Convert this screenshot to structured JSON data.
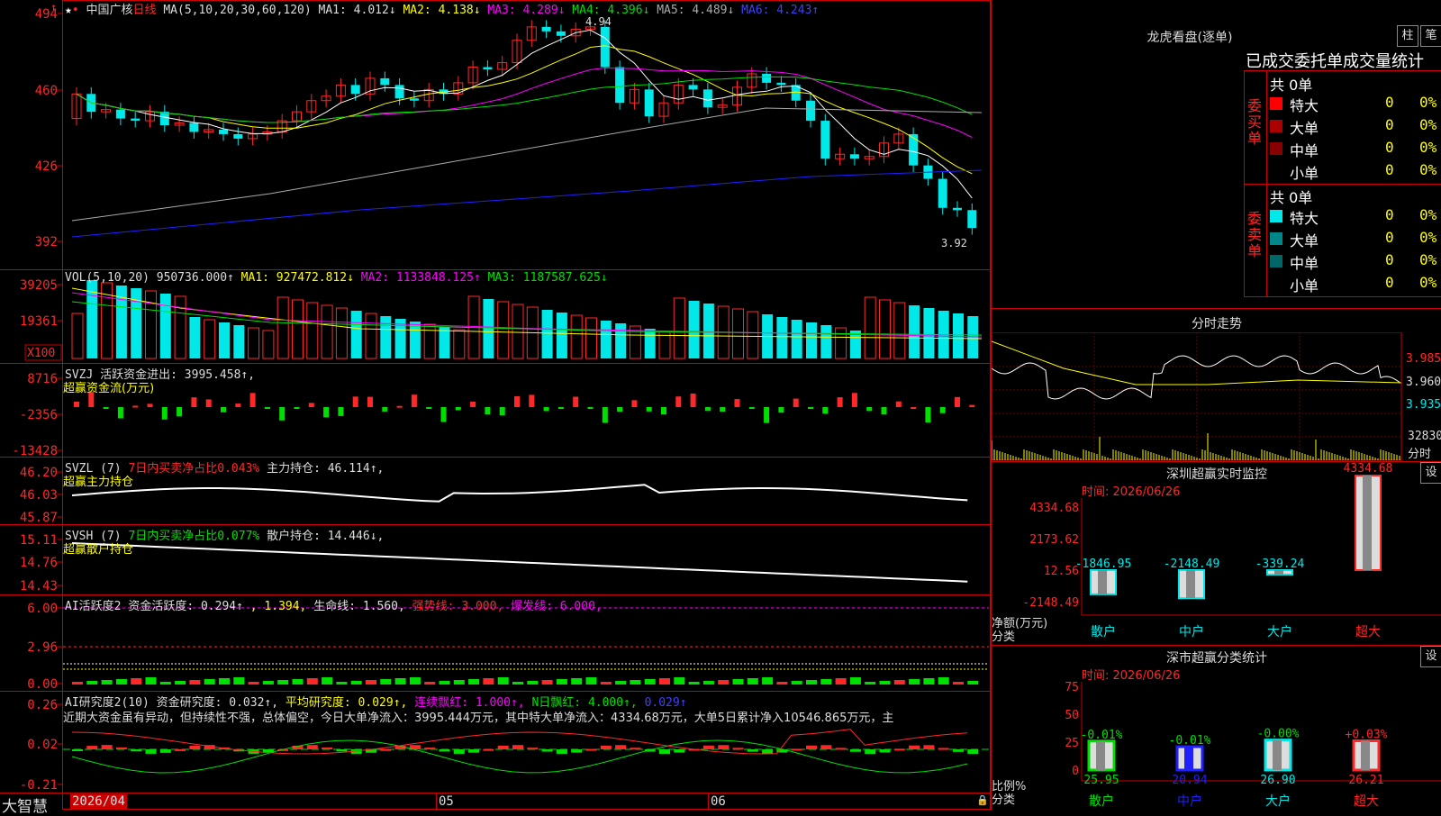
{
  "stock": {
    "name": "中国广核",
    "period": "日线"
  },
  "brand": "大智慧",
  "colors": {
    "up": "#ff2828",
    "down": "#00e8e8",
    "axis": "#cc0000",
    "text": "#dddddd",
    "yellow": "#ffff00",
    "magenta": "#ff00ff",
    "green": "#00e000",
    "white": "#ffffff",
    "blue": "#2020ff",
    "grey": "#aaaaaa"
  },
  "price_panel": {
    "legend": [
      {
        "text": "MA(5,10,20,30,60,120)",
        "color": "#dddddd"
      },
      {
        "text": "MA1: 4.012↓",
        "color": "#dddddd"
      },
      {
        "text": "MA2: 4.138↓",
        "color": "#ffff00"
      },
      {
        "text": "MA3: 4.289↓",
        "color": "#ff00ff"
      },
      {
        "text": "MA4: 4.396↓",
        "color": "#00e000"
      },
      {
        "text": "MA5: 4.489↓",
        "color": "#aaaaaa"
      },
      {
        "text": "MA6: 4.243↑",
        "color": "#4040ff"
      }
    ],
    "yticks": [
      "494",
      "460",
      "426",
      "392"
    ],
    "high_label": "4.94",
    "low_label": "3.92"
  },
  "vol_panel": {
    "legend": [
      {
        "text": "VOL(5,10,20)",
        "color": "#dddddd"
      },
      {
        "text": "950736.000↑",
        "color": "#dddddd"
      },
      {
        "text": "MA1: 927472.812↓",
        "color": "#ffff00"
      },
      {
        "text": "MA2: 1133848.125↑",
        "color": "#ff00ff"
      },
      {
        "text": "MA3: 1187587.625↓",
        "color": "#00e000"
      }
    ],
    "yticks": [
      "39205",
      "19361"
    ],
    "unit": "X100"
  },
  "svzj_panel": {
    "legend": [
      {
        "text": "SVZJ",
        "color": "#dddddd"
      },
      {
        "text": "活跃资金进出: 3995.458↑,",
        "color": "#dddddd"
      }
    ],
    "sub": "超赢资金流(万元)",
    "yticks": [
      "8716",
      "-2356",
      "-13428"
    ]
  },
  "svzl_panel": {
    "legend": [
      {
        "text": "SVZL (7)",
        "color": "#dddddd"
      },
      {
        "text": "7日内买卖净占比0.043%",
        "color": "#ff2828"
      },
      {
        "text": "主力持仓: 46.114↑,",
        "color": "#dddddd"
      }
    ],
    "sub": "超赢主力持仓",
    "yticks": [
      "46.20",
      "46.03",
      "45.87"
    ]
  },
  "svsh_panel": {
    "legend": [
      {
        "text": "SVSH (7)",
        "color": "#dddddd"
      },
      {
        "text": "7日内买卖净占比0.077%",
        "color": "#00e000"
      },
      {
        "text": "散户持仓: 14.446↓,",
        "color": "#dddddd"
      }
    ],
    "sub": "超赢散户持仓",
    "yticks": [
      "15.11",
      "14.76",
      "14.43"
    ]
  },
  "ai1_panel": {
    "legend": [
      {
        "text": "AI活跃度2",
        "color": "#dddddd"
      },
      {
        "text": "资金活跃度: 0.294↑",
        "color": "#dddddd"
      },
      {
        "text": ", 1.394,",
        "color": "#ffff00"
      },
      {
        "text": "生命线: 1.560,",
        "color": "#dddddd"
      },
      {
        "text": "强势线: 3.000,",
        "color": "#ff2828"
      },
      {
        "text": "爆发线: 6.000,",
        "color": "#ff00ff"
      }
    ],
    "yticks": [
      "6.00",
      "2.96",
      "0.00"
    ]
  },
  "ai2_panel": {
    "legend": [
      {
        "text": "AI研究度2(10)",
        "color": "#dddddd"
      },
      {
        "text": "资金研究度: 0.032↑,",
        "color": "#dddddd"
      },
      {
        "text": "平均研究度: 0.029↑,",
        "color": "#ffff00"
      },
      {
        "text": "连续飘红: 1.000↑,",
        "color": "#ff00ff"
      },
      {
        "text": "N日飘红: 4.000↑,",
        "color": "#00e000"
      },
      {
        "text": "0.029↑",
        "color": "#4040ff"
      }
    ],
    "comment": "近期大资金虽有异动，但持续性不强，总体偏空，今日大单净流入：3995.444万元，其中特大单净流入：4334.68万元，大单5日累计净入10546.865万元，主",
    "yticks": [
      "0.26",
      "0.02",
      "-0.21"
    ]
  },
  "time_axis": [
    "2026/04",
    "05",
    "06"
  ],
  "longhu": {
    "title": "龙虎看盘(逐单)",
    "btn_bar": "柱",
    "btn_pen": "笔",
    "header": "已成交委托单成交量统计",
    "buy": {
      "side": "委买单",
      "total": "共 0单",
      "rows": [
        {
          "label": "特大",
          "n": "0",
          "p": "0%"
        },
        {
          "label": "大单",
          "n": "0",
          "p": "0%"
        },
        {
          "label": "中单",
          "n": "0",
          "p": "0%"
        },
        {
          "label": "小单",
          "n": "0",
          "p": "0%"
        }
      ]
    },
    "sell": {
      "side": "委卖单",
      "total": "共 0单",
      "rows": [
        {
          "label": "特大",
          "n": "0",
          "p": "0%"
        },
        {
          "label": "大单",
          "n": "0",
          "p": "0%"
        },
        {
          "label": "中单",
          "n": "0",
          "p": "0%"
        },
        {
          "label": "小单",
          "n": "0",
          "p": "0%"
        }
      ]
    }
  },
  "intraday": {
    "title": "分时走势",
    "prices": [
      "3.985",
      "3.960",
      "3.935"
    ],
    "vol": "32830",
    "vol_label": "分时"
  },
  "monitor": {
    "title": "深圳超赢实时监控",
    "btn": "设",
    "time": "时间: 2026/06/26",
    "yticks": [
      "4334.68",
      "2173.62",
      "12.56",
      "-2148.49"
    ],
    "ylabel": "净额(万元)",
    "xlabel": "分类",
    "bars": [
      {
        "cat": "散户",
        "value": "-1846.95"
      },
      {
        "cat": "中户",
        "value": "-2148.49"
      },
      {
        "cat": "大户",
        "value": "-339.24"
      },
      {
        "cat": "超大",
        "value": "4334.68"
      }
    ]
  },
  "classify": {
    "title": "深市超赢分类统计",
    "btn": "设",
    "time": "时间: 2026/06/26",
    "yticks": [
      "75",
      "50",
      "25",
      "0"
    ],
    "ylabel": "比例%",
    "xlabel": "分类",
    "bars": [
      {
        "cat": "散户",
        "value": "25.95",
        "change": "-0.01%"
      },
      {
        "cat": "中户",
        "value": "20.94",
        "change": "-0.01%"
      },
      {
        "cat": "大户",
        "value": "26.90",
        "change": "-0.00%"
      },
      {
        "cat": "超大",
        "value": "26.21",
        "change": "+0.03%"
      }
    ]
  }
}
